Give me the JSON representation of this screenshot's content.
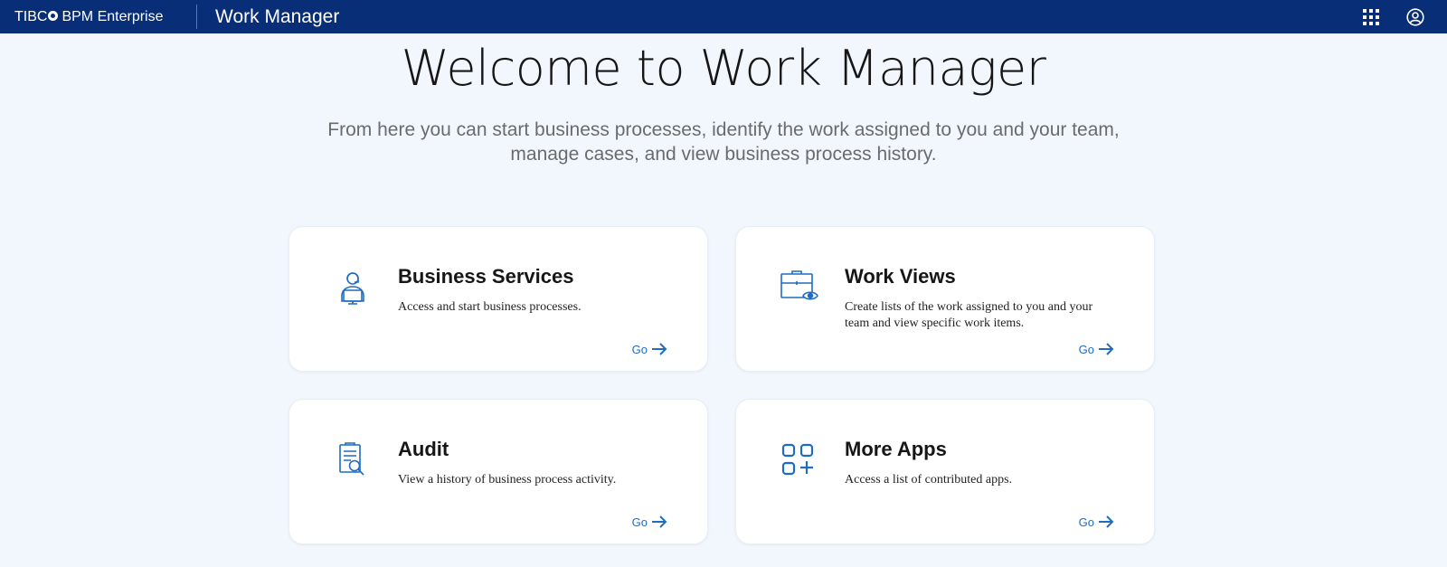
{
  "header": {
    "brand_prefix": "TIBC",
    "brand_suffix": "BPM Enterprise",
    "app_title": "Work Manager",
    "bar_color": "#082e78"
  },
  "hero": {
    "title": "Welcome to Work Manager",
    "subtitle_line1": "From here you can start business processes, identify the work assigned to you and your team,",
    "subtitle_line2": "manage cases, and view business process history."
  },
  "cards": [
    {
      "icon": "support-agent-icon",
      "title": "Business Services",
      "description": "Access and start business processes.",
      "go_label": "Go"
    },
    {
      "icon": "briefcase-eye-icon",
      "title": "Work Views",
      "description": "Create lists of the work assigned to you and your team and view specific work items.",
      "go_label": "Go"
    },
    {
      "icon": "clipboard-search-icon",
      "title": "Audit",
      "description": "View a history of business process activity.",
      "go_label": "Go"
    },
    {
      "icon": "app-grid-plus-icon",
      "title": "More Apps",
      "description": "Access a list of contributed apps.",
      "go_label": "Go"
    }
  ],
  "accent_color": "#1f6cc2"
}
